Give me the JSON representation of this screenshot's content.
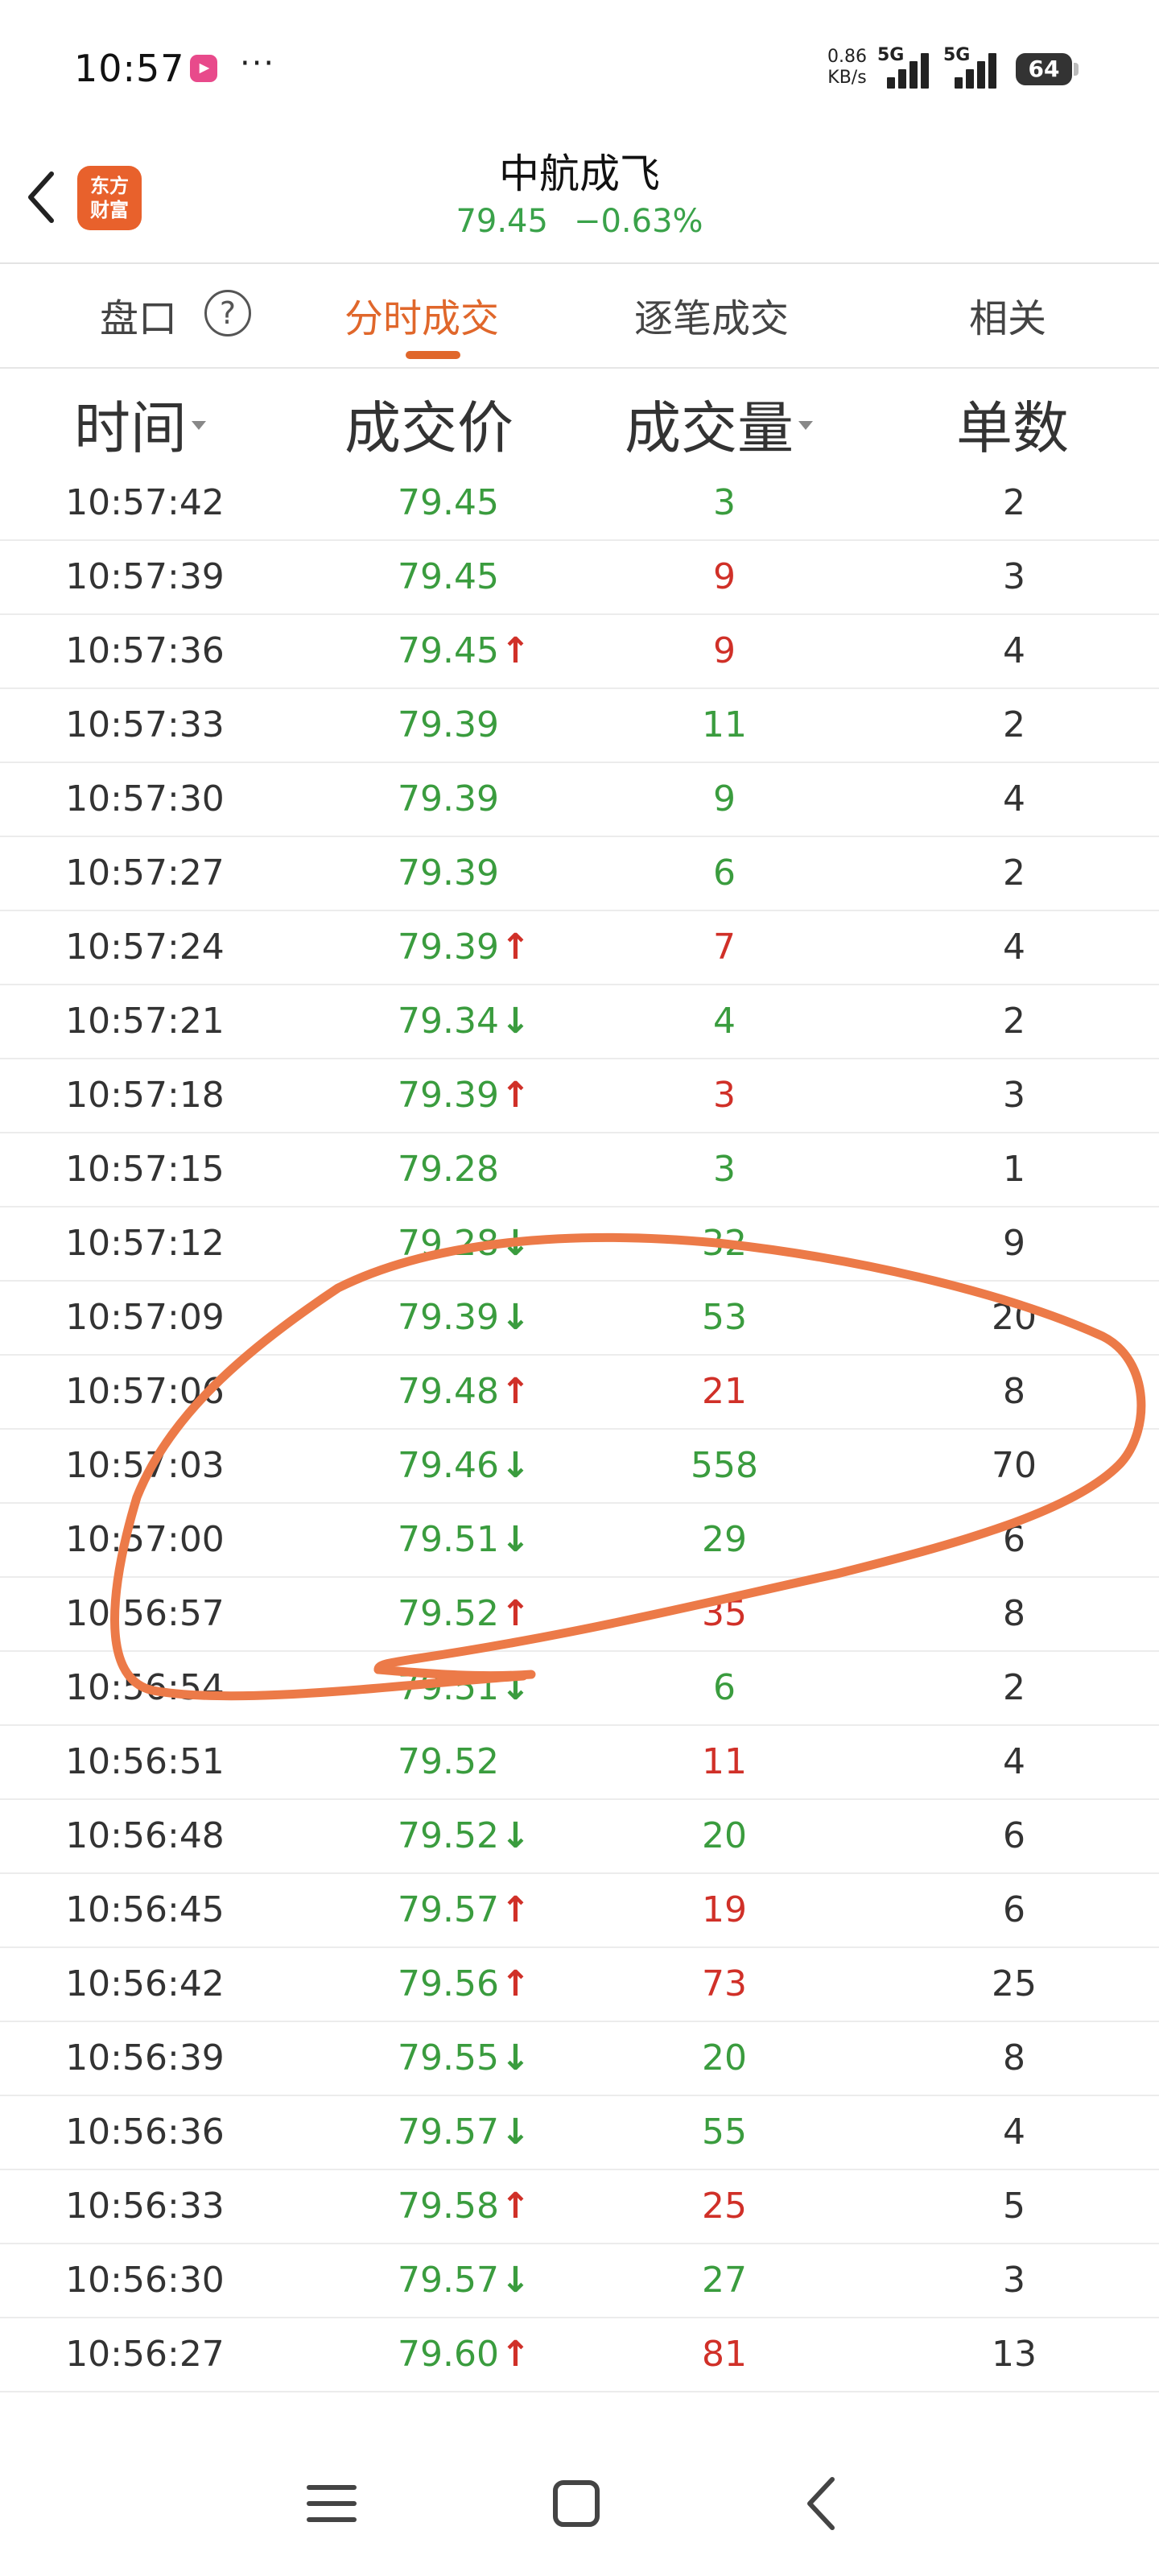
{
  "status_bar": {
    "time": "10:57",
    "dots": "···",
    "speed_value": "0.86",
    "speed_unit": "KB/s",
    "net1": "5G",
    "net2": "5G",
    "battery": "64"
  },
  "header": {
    "logo_line1": "东方",
    "logo_line2": "财富",
    "stock_name": "中航成飞",
    "price": "79.45",
    "change_pct": "−0.63%"
  },
  "tabs": [
    {
      "label": "盘口",
      "active": false
    },
    {
      "label": "分时成交",
      "active": true
    },
    {
      "label": "逐笔成交",
      "active": false
    },
    {
      "label": "相关",
      "active": false
    }
  ],
  "help_icon": "?",
  "columns": [
    "时间",
    "成交价",
    "成交量",
    "单数"
  ],
  "colors": {
    "up": "#d03028",
    "down": "#3a9c3e",
    "accent": "#e0672b",
    "annotation": "#ec7a48"
  },
  "rows": [
    {
      "time": "10:57:42",
      "price": "79.45",
      "arrow": "",
      "vol": "3",
      "vol_dir": "down",
      "cnt": "2"
    },
    {
      "time": "10:57:39",
      "price": "79.45",
      "arrow": "",
      "vol": "9",
      "vol_dir": "up",
      "cnt": "3"
    },
    {
      "time": "10:57:36",
      "price": "79.45",
      "arrow": "up",
      "vol": "9",
      "vol_dir": "up",
      "cnt": "4"
    },
    {
      "time": "10:57:33",
      "price": "79.39",
      "arrow": "",
      "vol": "11",
      "vol_dir": "down",
      "cnt": "2"
    },
    {
      "time": "10:57:30",
      "price": "79.39",
      "arrow": "",
      "vol": "9",
      "vol_dir": "down",
      "cnt": "4"
    },
    {
      "time": "10:57:27",
      "price": "79.39",
      "arrow": "",
      "vol": "6",
      "vol_dir": "down",
      "cnt": "2"
    },
    {
      "time": "10:57:24",
      "price": "79.39",
      "arrow": "up",
      "vol": "7",
      "vol_dir": "up",
      "cnt": "4"
    },
    {
      "time": "10:57:21",
      "price": "79.34",
      "arrow": "down",
      "vol": "4",
      "vol_dir": "down",
      "cnt": "2"
    },
    {
      "time": "10:57:18",
      "price": "79.39",
      "arrow": "up",
      "vol": "3",
      "vol_dir": "up",
      "cnt": "3"
    },
    {
      "time": "10:57:15",
      "price": "79.28",
      "arrow": "",
      "vol": "3",
      "vol_dir": "down",
      "cnt": "1"
    },
    {
      "time": "10:57:12",
      "price": "79.28",
      "arrow": "down",
      "vol": "32",
      "vol_dir": "down",
      "cnt": "9"
    },
    {
      "time": "10:57:09",
      "price": "79.39",
      "arrow": "down",
      "vol": "53",
      "vol_dir": "down",
      "cnt": "20"
    },
    {
      "time": "10:57:06",
      "price": "79.48",
      "arrow": "up",
      "vol": "21",
      "vol_dir": "up",
      "cnt": "8"
    },
    {
      "time": "10:57:03",
      "price": "79.46",
      "arrow": "down",
      "vol": "558",
      "vol_dir": "down",
      "cnt": "70"
    },
    {
      "time": "10:57:00",
      "price": "79.51",
      "arrow": "down",
      "vol": "29",
      "vol_dir": "down",
      "cnt": "6"
    },
    {
      "time": "10:56:57",
      "price": "79.52",
      "arrow": "up",
      "vol": "35",
      "vol_dir": "up",
      "cnt": "8"
    },
    {
      "time": "10:56:54",
      "price": "79.51",
      "arrow": "down",
      "vol": "6",
      "vol_dir": "down",
      "cnt": "2"
    },
    {
      "time": "10:56:51",
      "price": "79.52",
      "arrow": "",
      "vol": "11",
      "vol_dir": "up",
      "cnt": "4"
    },
    {
      "time": "10:56:48",
      "price": "79.52",
      "arrow": "down",
      "vol": "20",
      "vol_dir": "down",
      "cnt": "6"
    },
    {
      "time": "10:56:45",
      "price": "79.57",
      "arrow": "up",
      "vol": "19",
      "vol_dir": "up",
      "cnt": "6"
    },
    {
      "time": "10:56:42",
      "price": "79.56",
      "arrow": "up",
      "vol": "73",
      "vol_dir": "up",
      "cnt": "25"
    },
    {
      "time": "10:56:39",
      "price": "79.55",
      "arrow": "down",
      "vol": "20",
      "vol_dir": "down",
      "cnt": "8"
    },
    {
      "time": "10:56:36",
      "price": "79.57",
      "arrow": "down",
      "vol": "55",
      "vol_dir": "down",
      "cnt": "4"
    },
    {
      "time": "10:56:33",
      "price": "79.58",
      "arrow": "up",
      "vol": "25",
      "vol_dir": "up",
      "cnt": "5"
    },
    {
      "time": "10:56:30",
      "price": "79.57",
      "arrow": "down",
      "vol": "27",
      "vol_dir": "down",
      "cnt": "3"
    },
    {
      "time": "10:56:27",
      "price": "79.60",
      "arrow": "up",
      "vol": "81",
      "vol_dir": "up",
      "cnt": "13"
    }
  ],
  "nav": {
    "menu_icon": "menu-icon",
    "home_icon": "home-icon",
    "back_icon": "back-icon"
  }
}
